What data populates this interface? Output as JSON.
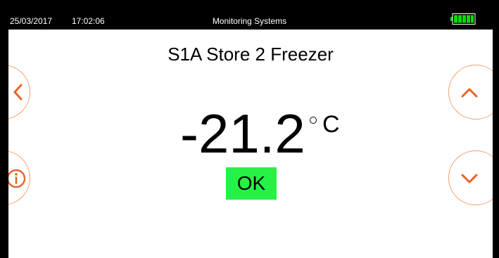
{
  "status_bar": {
    "date": "25/03/2017",
    "time": "17:02:06",
    "title": "Monitoring Systems",
    "battery_level": 1.0,
    "battery_color": "#00e000"
  },
  "main": {
    "device_name": "S1A Store 2 Freezer",
    "temperature": "-21.2",
    "unit": "C",
    "status": "OK",
    "status_color": "#26f246"
  },
  "nav": {
    "accent_color": "#e8632a",
    "left": [
      "chevron-left-icon",
      "info-icon"
    ],
    "right": [
      "chevron-up-icon",
      "chevron-down-icon"
    ]
  }
}
